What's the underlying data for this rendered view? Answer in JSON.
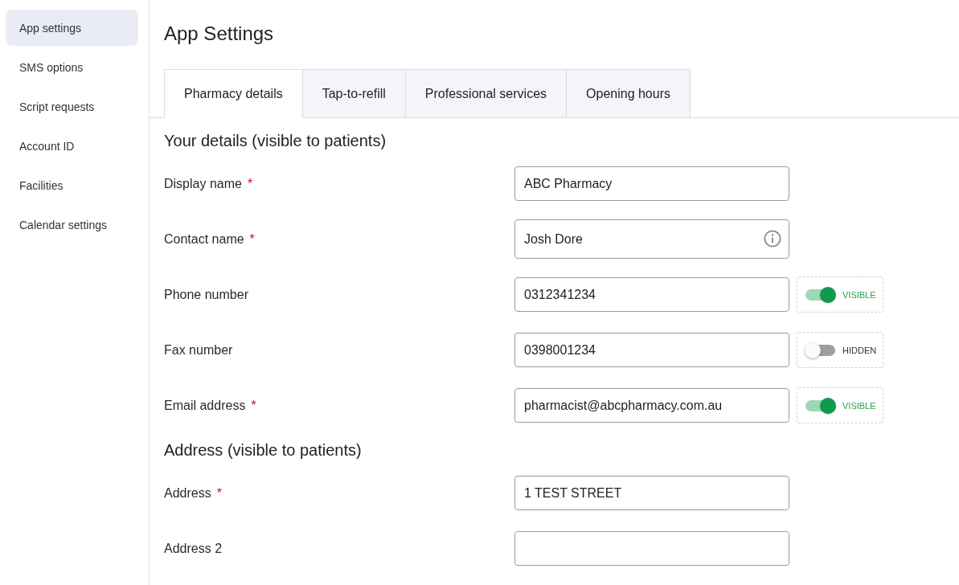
{
  "sidebar": {
    "items": [
      {
        "label": "App settings",
        "selected": true
      },
      {
        "label": "SMS options",
        "selected": false
      },
      {
        "label": "Script requests",
        "selected": false
      },
      {
        "label": "Account ID",
        "selected": false
      },
      {
        "label": "Facilities",
        "selected": false
      },
      {
        "label": "Calendar settings",
        "selected": false
      }
    ]
  },
  "page_title": "App Settings",
  "tabs": [
    {
      "label": "Pharmacy details",
      "selected": true
    },
    {
      "label": "Tap-to-refill",
      "selected": false
    },
    {
      "label": "Professional services",
      "selected": false
    },
    {
      "label": "Opening hours",
      "selected": false
    }
  ],
  "sections": [
    {
      "heading": "Your details (visible to patients)",
      "fields": [
        {
          "label": "Display name",
          "required_mark": "*",
          "value": "ABC Pharmacy"
        },
        {
          "label": "Contact name",
          "required_mark": "*",
          "value": "Josh Dore",
          "info_icon": true
        },
        {
          "label": "Phone number",
          "value": "0312341234",
          "visibility": {
            "on": true,
            "label": "VISIBLE"
          }
        },
        {
          "label": "Fax number",
          "value": "0398001234",
          "visibility": {
            "on": false,
            "label": "HIDDEN"
          }
        },
        {
          "label": "Email address",
          "required_mark": "*",
          "value": "pharmacist@abcpharmacy.com.au",
          "visibility": {
            "on": true,
            "label": "VISIBLE"
          }
        }
      ]
    },
    {
      "heading": "Address (visible to patients)",
      "fields": [
        {
          "label": "Address",
          "required_mark": "*",
          "value": "1 TEST STREET"
        },
        {
          "label": "Address 2"
        }
      ]
    }
  ]
}
